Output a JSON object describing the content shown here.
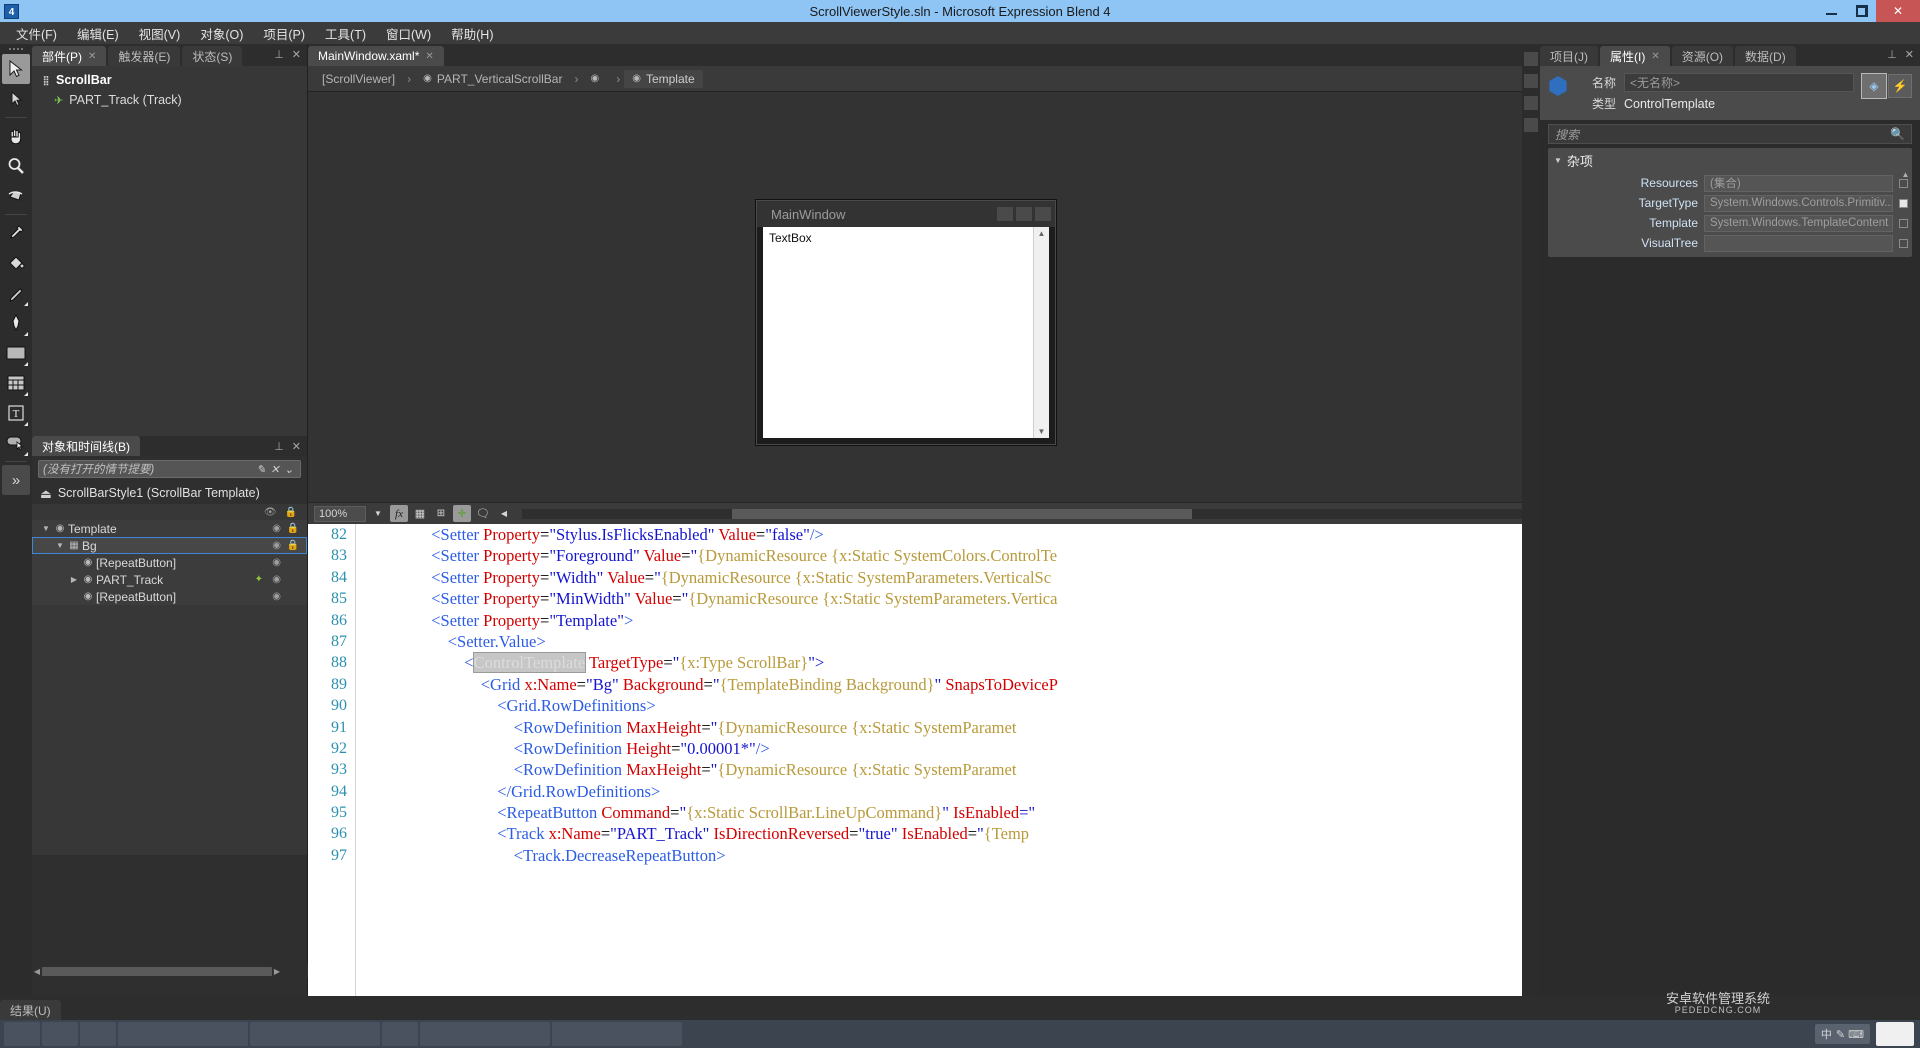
{
  "titlebar": {
    "title": "ScrollViewerStyle.sln - Microsoft Expression Blend 4",
    "logo": "4",
    "minimize": "minimize-icon",
    "maximize": "maximize-icon",
    "close": "✕"
  },
  "menubar": {
    "items": [
      "文件(F)",
      "编辑(E)",
      "视图(V)",
      "对象(O)",
      "项目(P)",
      "工具(T)",
      "窗口(W)",
      "帮助(H)"
    ]
  },
  "tools": [
    {
      "name": "selection-tool",
      "icon": "arrow",
      "selected": true,
      "sub": false
    },
    {
      "name": "direct-selection-tool",
      "icon": "arrow-small",
      "selected": false,
      "sub": false
    },
    {
      "name": "pan-tool",
      "icon": "hand",
      "selected": false,
      "sub": false
    },
    {
      "name": "zoom-tool",
      "icon": "magnifier",
      "selected": false,
      "sub": false
    },
    {
      "name": "camera-orbit-tool",
      "icon": "orbit",
      "selected": false,
      "sub": false
    },
    {
      "name": "eyedropper-tool",
      "icon": "eyedropper",
      "selected": false,
      "sub": false
    },
    {
      "name": "paint-bucket-tool",
      "icon": "bucket",
      "selected": false,
      "sub": false
    },
    {
      "name": "brush-tool",
      "icon": "brush",
      "selected": false,
      "sub": true
    },
    {
      "name": "pen-tool",
      "icon": "pen",
      "selected": false,
      "sub": true
    },
    {
      "name": "rectangle-tool",
      "icon": "rectangle",
      "selected": false,
      "sub": true
    },
    {
      "name": "grid-tool",
      "icon": "grid",
      "selected": false,
      "sub": true
    },
    {
      "name": "text-tool",
      "icon": "text",
      "selected": false,
      "sub": true
    },
    {
      "name": "button-tool",
      "icon": "button",
      "selected": false,
      "sub": true
    }
  ],
  "tools_more": "»",
  "left_panel": {
    "tabs": [
      {
        "label": "部件(P)",
        "active": true,
        "closable": true
      },
      {
        "label": "触发器(E)",
        "active": false,
        "closable": false
      },
      {
        "label": "状态(S)",
        "active": false,
        "closable": false
      }
    ],
    "tree": [
      {
        "label": "ScrollBar",
        "type": "header",
        "icon": "parts-icon"
      },
      {
        "label": "PART_Track (Track)",
        "type": "item",
        "icon": "track-icon"
      }
    ]
  },
  "objects_panel": {
    "tab_label": "对象和时间线(B)",
    "storyboard_placeholder": "(没有打开的情节提要)",
    "root_label": "ScrollBarStyle1 (ScrollBar Template)",
    "root_icon": "template-root-icon",
    "tree": [
      {
        "label": "Template",
        "indent": 0,
        "expander": "▼",
        "icon": "template-icon",
        "selected": false,
        "eye": true,
        "lock": true,
        "pin": false
      },
      {
        "label": "Bg",
        "indent": 1,
        "expander": "▼",
        "icon": "grid-icon",
        "selected": true,
        "eye": true,
        "lock": true,
        "pin": false
      },
      {
        "label": "[RepeatButton]",
        "indent": 2,
        "expander": "",
        "icon": "template-icon",
        "selected": false,
        "eye": true,
        "lock": false,
        "pin": false
      },
      {
        "label": "PART_Track",
        "indent": 2,
        "expander": "▶",
        "icon": "template-icon",
        "selected": false,
        "eye": true,
        "lock": false,
        "pin": true
      },
      {
        "label": "[RepeatButton]",
        "indent": 2,
        "expander": "",
        "icon": "template-icon",
        "selected": false,
        "eye": true,
        "lock": false,
        "pin": false
      }
    ]
  },
  "document_tab": {
    "label": "MainWindow.xaml*",
    "close": "✕"
  },
  "breadcrumb": [
    {
      "label": "[ScrollViewer]",
      "icon": "",
      "active": false
    },
    {
      "label": "PART_VerticalScrollBar",
      "icon": "template-icon",
      "active": false
    },
    {
      "label": "",
      "icon": "scrollbar-icon",
      "active": false
    },
    {
      "label": "Template",
      "icon": "template-icon",
      "active": true
    }
  ],
  "breadcrumb_separator": "›",
  "artboard": {
    "window_title": "MainWindow",
    "textbox_value": "TextBox",
    "scroll_up": "▲",
    "scroll_down": "▼"
  },
  "design_toolbar": {
    "zoom": "100%",
    "chevron": "▼",
    "buttons": [
      {
        "name": "effects-button",
        "glyph": "fx",
        "on": true
      },
      {
        "name": "show-grid-button",
        "glyph": "grid",
        "on": false
      },
      {
        "name": "snap-to-gridlines-button",
        "glyph": "snap",
        "on": false
      },
      {
        "name": "snap-to-snaplines-button",
        "glyph": "node",
        "on": true
      },
      {
        "name": "annotations-button",
        "glyph": "note",
        "on": false
      }
    ],
    "collapse": "◀"
  },
  "editor": {
    "lines": [
      {
        "no": "82",
        "indent": 9,
        "tokens": [
          {
            "t": "<Setter ",
            "c": "tag"
          },
          {
            "t": "Property",
            "c": "attr"
          },
          {
            "t": "=",
            "c": "blk"
          },
          {
            "t": "\"Stylus.IsFlicksEnabled\"",
            "c": "str"
          },
          {
            "t": " ",
            "c": "blk"
          },
          {
            "t": "Value",
            "c": "attr"
          },
          {
            "t": "=",
            "c": "blk"
          },
          {
            "t": "\"false\"",
            "c": "str"
          },
          {
            "t": "/>",
            "c": "tag"
          }
        ]
      },
      {
        "no": "83",
        "indent": 9,
        "tokens": [
          {
            "t": "<Setter ",
            "c": "tag"
          },
          {
            "t": "Property",
            "c": "attr"
          },
          {
            "t": "=",
            "c": "blk"
          },
          {
            "t": "\"Foreground\"",
            "c": "str"
          },
          {
            "t": " ",
            "c": "blk"
          },
          {
            "t": "Value",
            "c": "attr"
          },
          {
            "t": "=",
            "c": "blk"
          },
          {
            "t": "\"",
            "c": "str"
          },
          {
            "t": "{DynamicResource {x:Static SystemColors.ControlTe",
            "c": "brace"
          }
        ]
      },
      {
        "no": "84",
        "indent": 9,
        "tokens": [
          {
            "t": "<Setter ",
            "c": "tag"
          },
          {
            "t": "Property",
            "c": "attr"
          },
          {
            "t": "=",
            "c": "blk"
          },
          {
            "t": "\"Width\"",
            "c": "str"
          },
          {
            "t": " ",
            "c": "blk"
          },
          {
            "t": "Value",
            "c": "attr"
          },
          {
            "t": "=",
            "c": "blk"
          },
          {
            "t": "\"",
            "c": "str"
          },
          {
            "t": "{DynamicResource {x:Static SystemParameters.VerticalSc",
            "c": "brace"
          }
        ]
      },
      {
        "no": "85",
        "indent": 9,
        "tokens": [
          {
            "t": "<Setter ",
            "c": "tag"
          },
          {
            "t": "Property",
            "c": "attr"
          },
          {
            "t": "=",
            "c": "blk"
          },
          {
            "t": "\"MinWidth\"",
            "c": "str"
          },
          {
            "t": " ",
            "c": "blk"
          },
          {
            "t": "Value",
            "c": "attr"
          },
          {
            "t": "=",
            "c": "blk"
          },
          {
            "t": "\"",
            "c": "str"
          },
          {
            "t": "{DynamicResource {x:Static SystemParameters.Vertica",
            "c": "brace"
          }
        ]
      },
      {
        "no": "86",
        "indent": 9,
        "tokens": [
          {
            "t": "<Setter ",
            "c": "tag"
          },
          {
            "t": "Property",
            "c": "attr"
          },
          {
            "t": "=",
            "c": "blk"
          },
          {
            "t": "\"Template\"",
            "c": "str"
          },
          {
            "t": ">",
            "c": "tag"
          }
        ]
      },
      {
        "no": "87",
        "indent": 11,
        "tokens": [
          {
            "t": "<Setter.Value>",
            "c": "tag"
          }
        ]
      },
      {
        "no": "88",
        "indent": 13,
        "tokens": [
          {
            "t": "<",
            "c": "tag"
          },
          {
            "t": "ControlTemplate",
            "c": "hl"
          },
          {
            "t": " ",
            "c": "blk"
          },
          {
            "t": "TargetType",
            "c": "attr"
          },
          {
            "t": "=",
            "c": "blk"
          },
          {
            "t": "\"",
            "c": "str"
          },
          {
            "t": "{x:Type ScrollBar}",
            "c": "brace"
          },
          {
            "t": "\">",
            "c": "str"
          }
        ]
      },
      {
        "no": "89",
        "indent": 15,
        "tokens": [
          {
            "t": "<Grid ",
            "c": "tag"
          },
          {
            "t": "x:Name",
            "c": "attr"
          },
          {
            "t": "=",
            "c": "blk"
          },
          {
            "t": "\"Bg\"",
            "c": "str"
          },
          {
            "t": " ",
            "c": "blk"
          },
          {
            "t": "Background",
            "c": "attr"
          },
          {
            "t": "=",
            "c": "blk"
          },
          {
            "t": "\"",
            "c": "str"
          },
          {
            "t": "{TemplateBinding Background}",
            "c": "brace"
          },
          {
            "t": "\" ",
            "c": "str"
          },
          {
            "t": "SnapsToDeviceP",
            "c": "attr"
          }
        ]
      },
      {
        "no": "90",
        "indent": 17,
        "tokens": [
          {
            "t": "<Grid.RowDefinitions>",
            "c": "tag"
          }
        ]
      },
      {
        "no": "91",
        "indent": 19,
        "tokens": [
          {
            "t": "<RowDefinition ",
            "c": "tag"
          },
          {
            "t": "MaxHeight",
            "c": "attr"
          },
          {
            "t": "=",
            "c": "blk"
          },
          {
            "t": "\"",
            "c": "str"
          },
          {
            "t": "{DynamicResource {x:Static SystemParamet",
            "c": "brace"
          }
        ]
      },
      {
        "no": "92",
        "indent": 19,
        "tokens": [
          {
            "t": "<RowDefinition ",
            "c": "tag"
          },
          {
            "t": "Height",
            "c": "attr"
          },
          {
            "t": "=",
            "c": "blk"
          },
          {
            "t": "\"0.00001*\"",
            "c": "str"
          },
          {
            "t": "/>",
            "c": "tag"
          }
        ]
      },
      {
        "no": "93",
        "indent": 19,
        "tokens": [
          {
            "t": "<RowDefinition ",
            "c": "tag"
          },
          {
            "t": "MaxHeight",
            "c": "attr"
          },
          {
            "t": "=",
            "c": "blk"
          },
          {
            "t": "\"",
            "c": "str"
          },
          {
            "t": "{DynamicResource {x:Static SystemParamet",
            "c": "brace"
          }
        ]
      },
      {
        "no": "94",
        "indent": 17,
        "tokens": [
          {
            "t": "</Grid.RowDefinitions>",
            "c": "tag"
          }
        ]
      },
      {
        "no": "95",
        "indent": 17,
        "tokens": [
          {
            "t": "<RepeatButton ",
            "c": "tag"
          },
          {
            "t": "Command",
            "c": "attr"
          },
          {
            "t": "=",
            "c": "blk"
          },
          {
            "t": "\"",
            "c": "str"
          },
          {
            "t": "{x:Static ScrollBar.LineUpCommand}",
            "c": "brace"
          },
          {
            "t": "\" ",
            "c": "str"
          },
          {
            "t": "IsEnabled",
            "c": "attr"
          },
          {
            "t": "=\"",
            "c": "str"
          }
        ]
      },
      {
        "no": "96",
        "indent": 17,
        "tokens": [
          {
            "t": "<Track ",
            "c": "tag"
          },
          {
            "t": "x:Name",
            "c": "attr"
          },
          {
            "t": "=",
            "c": "blk"
          },
          {
            "t": "\"PART_Track\"",
            "c": "str"
          },
          {
            "t": " ",
            "c": "blk"
          },
          {
            "t": "IsDirectionReversed",
            "c": "attr"
          },
          {
            "t": "=",
            "c": "blk"
          },
          {
            "t": "\"true\"",
            "c": "str"
          },
          {
            "t": " ",
            "c": "blk"
          },
          {
            "t": "IsEnabled",
            "c": "attr"
          },
          {
            "t": "=",
            "c": "blk"
          },
          {
            "t": "\"",
            "c": "str"
          },
          {
            "t": "{Temp",
            "c": "brace"
          }
        ]
      },
      {
        "no": "97",
        "indent": 19,
        "tokens": [
          {
            "t": "<Track.DecreaseRepeatButton>",
            "c": "tag"
          }
        ]
      }
    ]
  },
  "right_panel": {
    "tabs": [
      {
        "label": "项目(J)",
        "active": false,
        "closable": false
      },
      {
        "label": "属性(I)",
        "active": true,
        "closable": true
      },
      {
        "label": "资源(O)",
        "active": false,
        "closable": false
      },
      {
        "label": "数据(D)",
        "active": false,
        "closable": false
      }
    ],
    "pin": "pin-icon",
    "close": "✕",
    "name_label": "名称",
    "name_placeholder": "<无名称>",
    "type_label": "类型",
    "type_value": "ControlTemplate",
    "search_placeholder": "搜索",
    "group_title": "杂项",
    "group_triangle": "▼",
    "properties": [
      {
        "name": "Resources",
        "value": "(集合)",
        "marker": "empty"
      },
      {
        "name": "TargetType",
        "value": "System.Windows.Controls.Primitiv...",
        "marker": "filled"
      },
      {
        "name": "Template",
        "value": "System.Windows.TemplateContent",
        "marker": "empty"
      },
      {
        "name": "VisualTree",
        "value": "",
        "marker": "empty"
      }
    ]
  },
  "results": {
    "tab_label": "结果(U)"
  },
  "taskbar": {
    "ime": {
      "lang": "中",
      "glyphs": "✎ ⌨"
    },
    "watermark": "安卓软件管理系统",
    "watermark_sub": "PEDEDCNG.COM"
  }
}
